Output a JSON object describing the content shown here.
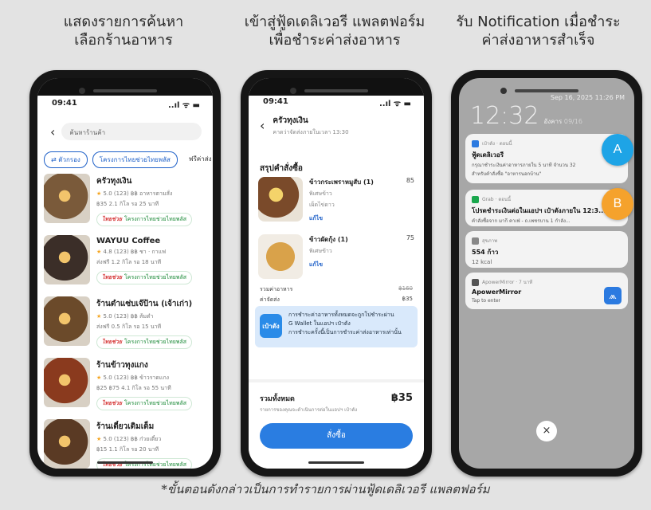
{
  "headings": {
    "step1": [
      "แสดงรายการค้นหา",
      "เลือกร้านอาหาร"
    ],
    "step2": [
      "เข้าสู่ฟู้ดเดลิเวอรี แพลตฟอร์ม",
      "เพื่อชำระค่าส่งอาหาร"
    ],
    "step3": [
      "รับ Notification เมื่อชำระ",
      "ค่าส่งอาหารสำเร็จ"
    ]
  },
  "footnote": "*ขั้นตอนดังกล่าวเป็นการทำรายการผ่านฟู้ดเดลิเวอรี แพลตฟอร์ม",
  "phone1": {
    "time": "09:41",
    "signal": "..ıl ᯤ ▬",
    "search_placeholder": "ค้นหาร้านค้า",
    "chips": [
      "ตัวกรอง",
      "โครงการไทยช่วยไทยพลัส",
      "ฟรีค่าส่ง"
    ],
    "badge_text": "โครงการไทยช่วยไทยพลัส",
    "badge_logo": "ไทยช่วย",
    "shops": [
      {
        "name": "ครัวทุงเงิน",
        "meta": "5.0 (123) ฿฿ อาหารตามสั่ง",
        "dist": "฿35 2.1 กิโล รอ 25 นาที",
        "color": "#7a5a3a"
      },
      {
        "name": "WAYUU Coffee",
        "meta": "4.8 (123) ฿฿ ชา · กาแฟ",
        "dist": "ส่งฟรี 1.2 กิโล รอ 18 นาที",
        "color": "#3b2e28"
      },
      {
        "name": "ร้านตำแซ่บเจ๊ป้าน (เจ้าเก่า)",
        "meta": "5.0 (123) ฿฿ ส้มตำ",
        "dist": "ส่งฟรี 0.5 กิโล รอ 15 นาที",
        "color": "#6b4a2a"
      },
      {
        "name": "ร้านข้าวทุงแกง",
        "meta": "5.0 (123) ฿฿ ข้าวราดแกง",
        "dist": "฿25 ฿75 4.1 กิโล รอ 55 นาที",
        "color": "#8a3a1e"
      },
      {
        "name": "ร้านเตี๋ยวเติมเต็ม",
        "meta": "5.0 (123) ฿฿ ก๋วยเตี๋ยว",
        "dist": "฿15 1.1 กิโล รอ 20 นาที",
        "color": "#5a3a24"
      }
    ]
  },
  "phone2": {
    "time": "09:41",
    "signal": "..ıl ᯤ ▬",
    "shop_title": "ครัวทุงเงิน",
    "shop_sub": "คาดว่าจัดส่งภายในเวลา 13:30",
    "summary_title": "สรุปคำสั่งซื้อ",
    "items": [
      {
        "name": "ข้าวกระเพราหมูสับ (1)",
        "opt1": "พิเศษข้าว",
        "opt2": "เผ็ดไข่ดาว",
        "edit": "แก้ไข",
        "price": "85",
        "color": "#7a4a2a"
      },
      {
        "name": "ข้าวผัดกุ้ง (1)",
        "opt1": "พิเศษข้าว",
        "opt2": "",
        "edit": "แก้ไข",
        "price": "75",
        "color": "#b07a3a"
      }
    ],
    "food_total_label": "รวมค่าอาหาร",
    "food_total_value": "฿160",
    "delivery_label": "ค่าจัดส่ง",
    "delivery_value": "฿35",
    "wallet_icon": "เป๋าตัง",
    "wallet_lines": [
      "การชำระค่าอาหารทั้งหมดจะถูกโปชำระผ่าน",
      "G Wallet ในแอปฯ เป๋าตัง",
      "การชำระครั้งนี้เป็นการชำระค่าส่งอาหารเท่านั้น"
    ],
    "total_label": "รวมทั้งหมด",
    "total_value": "฿35",
    "total_note": "รายการของคุณจะดำเนินการต่อในแอปฯ เป๋าตัง",
    "order_button": "สั่งซื้อ"
  },
  "phone3": {
    "top_date": "Sep 16, 2025 11:26 PM",
    "clock": "12:32",
    "clock_date": "อังคาร 09/16",
    "notifications": [
      {
        "app": "เป๋าตัง · ตอนนี้",
        "title": "ฟู้ดเดลิเวอรี",
        "body1": "กรุณาชำระเงินค่าอาหารภายใน 5 นาที จำนวน 32",
        "body2": "สำหรับคำสั่งซื้อ \"อาหารนอกบ้าน\"",
        "color": "#2b7ae0"
      },
      {
        "app": "Grab · ตอนนี้",
        "title": "โปรดชำระเงินต่อในแอปฯ เป๋าตังภายใน 12:3...",
        "body1": "คำสั่งซื้อจาก มากี คาเฟ่ - ถ.เพชรบาน 1 กำลัง...",
        "body2": "",
        "color": "#1aa74d"
      },
      {
        "app": "สุขภาพ",
        "title": "554 ก้าว",
        "body1": "12 kcal",
        "body2": "",
        "color": "#888888"
      },
      {
        "app": "ApowerMirror · 7 นาที",
        "title": "ApowerMirror",
        "body1": "Tap to enter",
        "body2": "",
        "color": "#555555"
      }
    ],
    "close_icon": "×",
    "markers": [
      "A",
      "B"
    ]
  }
}
